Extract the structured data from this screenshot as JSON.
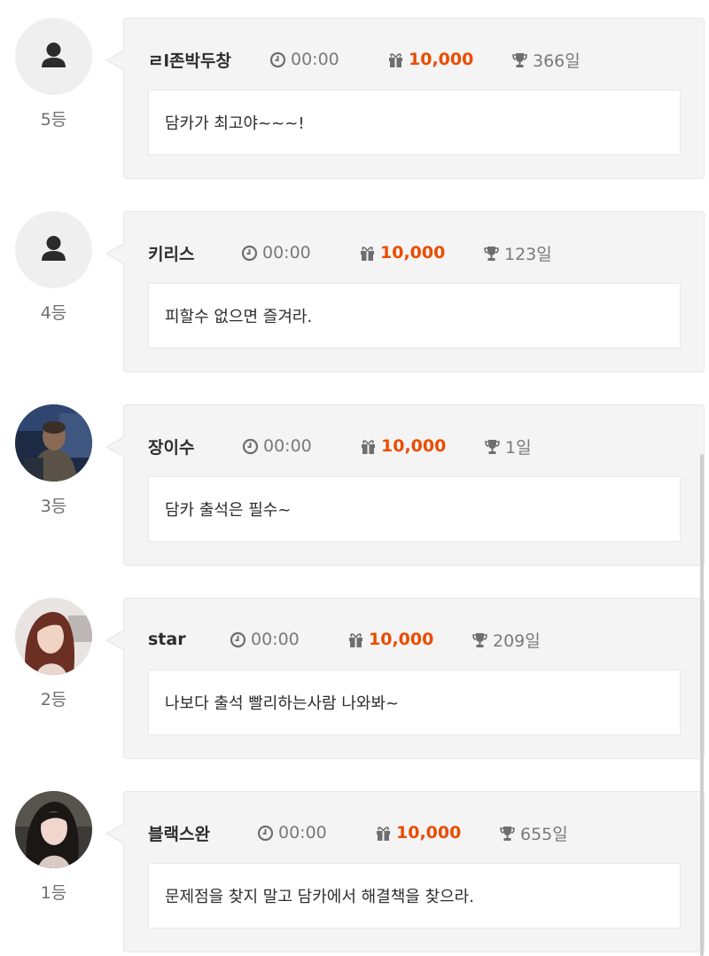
{
  "entries": [
    {
      "rank_label": "5등",
      "nickname": "ㄹl존박두창",
      "time": "00:00",
      "points": "10,000",
      "days": "366일",
      "message": "담카가 최고야~~~!",
      "avatar": "default-user-icon"
    },
    {
      "rank_label": "4등",
      "nickname": "키리스",
      "time": "00:00",
      "points": "10,000",
      "days": "123일",
      "message": "피할수 없으면 즐겨라.",
      "avatar": "default-user-icon"
    },
    {
      "rank_label": "3등",
      "nickname": "장이수",
      "time": "00:00",
      "points": "10,000",
      "days": "1일",
      "message": "담카 출석은 필수~",
      "avatar": "photo-man-in-dark-room"
    },
    {
      "rank_label": "2등",
      "nickname": "star",
      "time": "00:00",
      "points": "10,000",
      "days": "209일",
      "message": "나보다 출석 빨리하는사람 나와봐~",
      "avatar": "photo-woman-long-hair"
    },
    {
      "rank_label": "1등",
      "nickname": "블랙스완",
      "time": "00:00",
      "points": "10,000",
      "days": "655일",
      "message": "문제점을 찾지 말고 담카에서 해결책을 찾으라.",
      "avatar": "photo-woman-dark-hair"
    }
  ],
  "colors": {
    "points": "#ea4c00",
    "card_bg": "#f4f4f4",
    "avatar_bg": "#efefef"
  },
  "icons": {
    "time": "clock-icon",
    "points": "gift-icon",
    "days": "trophy-icon"
  }
}
